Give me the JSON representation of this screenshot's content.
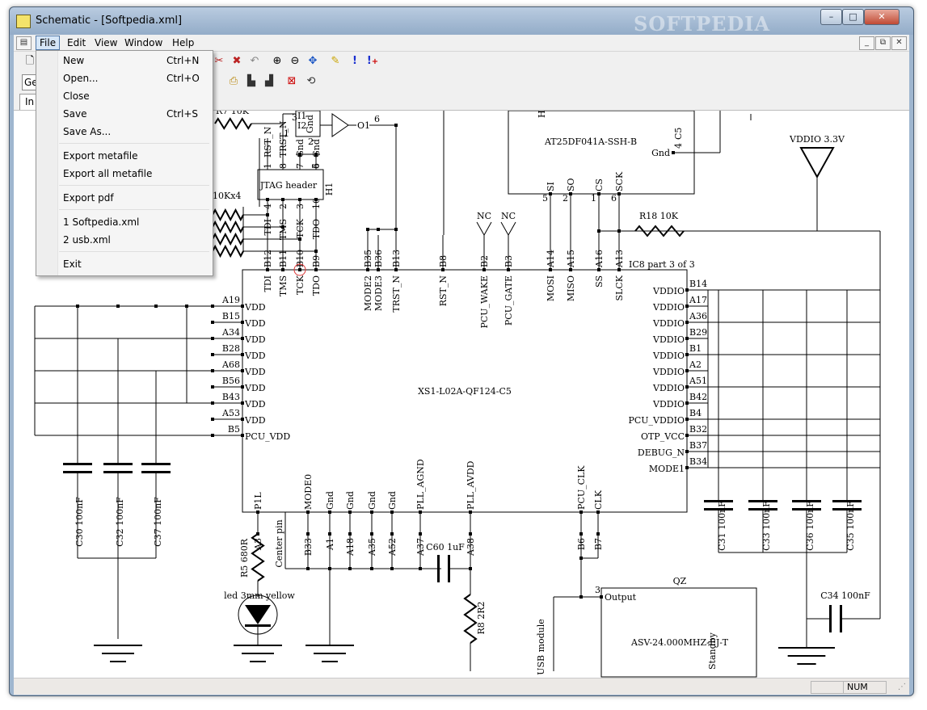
{
  "window": {
    "title": "Schematic - [Softpedia.xml]",
    "watermark": "SOFTPEDIA",
    "min": "–",
    "max": "□",
    "close": "✕"
  },
  "menubar": {
    "items": [
      "File",
      "Edit",
      "View",
      "Window",
      "Help"
    ]
  },
  "toolbar2": {
    "combo_value": "Ge"
  },
  "tabs": {
    "active": "In"
  },
  "file_menu": {
    "items": [
      {
        "label": "New",
        "shortcut": "Ctrl+N"
      },
      {
        "label": "Open...",
        "shortcut": "Ctrl+O"
      },
      {
        "label": "Close",
        "shortcut": ""
      },
      {
        "label": "Save",
        "shortcut": "Ctrl+S"
      },
      {
        "label": "Save As...",
        "shortcut": ""
      },
      {
        "label": "Export metafile",
        "shortcut": ""
      },
      {
        "label": "Export all metafile",
        "shortcut": ""
      },
      {
        "label": "Export pdf",
        "shortcut": ""
      },
      {
        "label": "1 Softpedia.xml",
        "shortcut": ""
      },
      {
        "label": "2 usb.xml",
        "shortcut": ""
      },
      {
        "label": "Exit",
        "shortcut": ""
      }
    ]
  },
  "statusbar": {
    "num": "NUM"
  },
  "schematic": {
    "chip_name": "XS1-L02A-QF124-C5",
    "part_label": "IC8 part 3 of 3",
    "flash": {
      "name": "AT25DF041A-SSH-B",
      "gnd": "Gnd",
      "pin_num": "4",
      "pin_name": "C5",
      "h": "H"
    },
    "vddio_supply": "VDDIO 3.3V",
    "r18": "R18 10K",
    "nc": "NC",
    "r_top": "R7 10K",
    "rx4": "10Kx4",
    "jtag": {
      "label": "JTAG header",
      "ref": "H1"
    },
    "buffer": {
      "i1": "I1",
      "i2": "I2",
      "gnd": "Gnd",
      "out": "O1",
      "n6": "6",
      "n1": "1",
      "n2": "2",
      "n3": "3"
    },
    "crystal": {
      "ref": "QZ",
      "name": "ASV-24.000MHZ-EJ-T",
      "pin3": "3",
      "output": "Output",
      "usb_module": "USB module",
      "standby": "Standby"
    },
    "c60": "C60 1uF",
    "c34": "C34 100nF",
    "r5": "R5 680R",
    "r8": "R8 2R2",
    "led": "led 3mm yellow",
    "center_pin": "Center pin",
    "left_caps": [
      "C30 100nF",
      "C32 100nF",
      "C37 100nF"
    ],
    "right_caps": [
      "C31 100nF",
      "C33 100nF",
      "C36 100nF",
      "C35 100nF"
    ],
    "jtag_pins_top": [
      {
        "a": "TDI",
        "b": "B12"
      },
      {
        "a": "TMS",
        "b": "B11"
      },
      {
        "a": "TCK",
        "b": "B10"
      },
      {
        "a": "TDO",
        "b": "B9"
      }
    ],
    "jtag_hdr_pins": [
      {
        "n": "1",
        "s": "RST_N"
      },
      {
        "n": "8",
        "s": "TRST_N"
      },
      {
        "n": "7",
        "s": "Gnd"
      },
      {
        "n": "6",
        "s": "Gnd"
      },
      {
        "n": "5",
        "s": ""
      }
    ],
    "jtag_hdr_bottom": [
      {
        "n": "4",
        "s": "TDI"
      },
      {
        "n": "2",
        "s": "TMS"
      },
      {
        "n": "3",
        "s": "TCK"
      },
      {
        "n": "10",
        "s": "TDO"
      }
    ],
    "top_pins": [
      {
        "n": "B35",
        "s": "MODE2"
      },
      {
        "n": "B36",
        "s": "MODE3"
      },
      {
        "n": "B13",
        "s": "TRST_N"
      },
      {
        "n": "B8",
        "s": "RST_N"
      },
      {
        "n": "B2",
        "s": "PCU_WAKE"
      },
      {
        "n": "B3",
        "s": "PCU_GATE"
      },
      {
        "n": "A14",
        "s": "MOSI"
      },
      {
        "n": "A15",
        "s": "MISO"
      },
      {
        "n": "A16",
        "s": "SS"
      },
      {
        "n": "A13",
        "s": "SLCK"
      }
    ],
    "flash_pins": [
      {
        "n": "5",
        "s": "SI"
      },
      {
        "n": "2",
        "s": "SO"
      },
      {
        "n": "1",
        "s": "CS"
      },
      {
        "n": "6",
        "s": "SCK"
      }
    ],
    "left_pins": [
      {
        "n": "A19",
        "s": "VDD"
      },
      {
        "n": "B15",
        "s": "VDD"
      },
      {
        "n": "A34",
        "s": "VDD"
      },
      {
        "n": "B28",
        "s": "VDD"
      },
      {
        "n": "A68",
        "s": "VDD"
      },
      {
        "n": "B56",
        "s": "VDD"
      },
      {
        "n": "B43",
        "s": "VDD"
      },
      {
        "n": "A53",
        "s": "VDD"
      },
      {
        "n": "B5",
        "s": "PCU_VDD"
      }
    ],
    "right_pins": [
      {
        "n": "B14",
        "s": "VDDIO"
      },
      {
        "n": "A17",
        "s": "VDDIO"
      },
      {
        "n": "A36",
        "s": "VDDIO"
      },
      {
        "n": "B29",
        "s": "VDDIO"
      },
      {
        "n": "B1",
        "s": "VDDIO"
      },
      {
        "n": "A2",
        "s": "VDDIO"
      },
      {
        "n": "A51",
        "s": "VDDIO"
      },
      {
        "n": "B42",
        "s": "VDDIO"
      },
      {
        "n": "B4",
        "s": "PCU_VDDIO"
      },
      {
        "n": "B32",
        "s": "OTP_VCC"
      },
      {
        "n": "B37",
        "s": "DEBUG_N"
      },
      {
        "n": "B34",
        "s": "MODE1"
      }
    ],
    "bottom_pins": [
      {
        "n": "A3",
        "s": "P1L"
      },
      {
        "n": "B33",
        "s": "MODE0"
      },
      {
        "n": "A1",
        "s": "Gnd"
      },
      {
        "n": "A18",
        "s": "Gnd"
      },
      {
        "n": "A35",
        "s": "Gnd"
      },
      {
        "n": "A52",
        "s": "Gnd"
      },
      {
        "n": "A37",
        "s": "PLL_AGND"
      },
      {
        "n": "A38",
        "s": "PLL_AVDD"
      },
      {
        "n": "B6",
        "s": "PCU_CLK"
      },
      {
        "n": "B7",
        "s": "CLK"
      }
    ]
  }
}
